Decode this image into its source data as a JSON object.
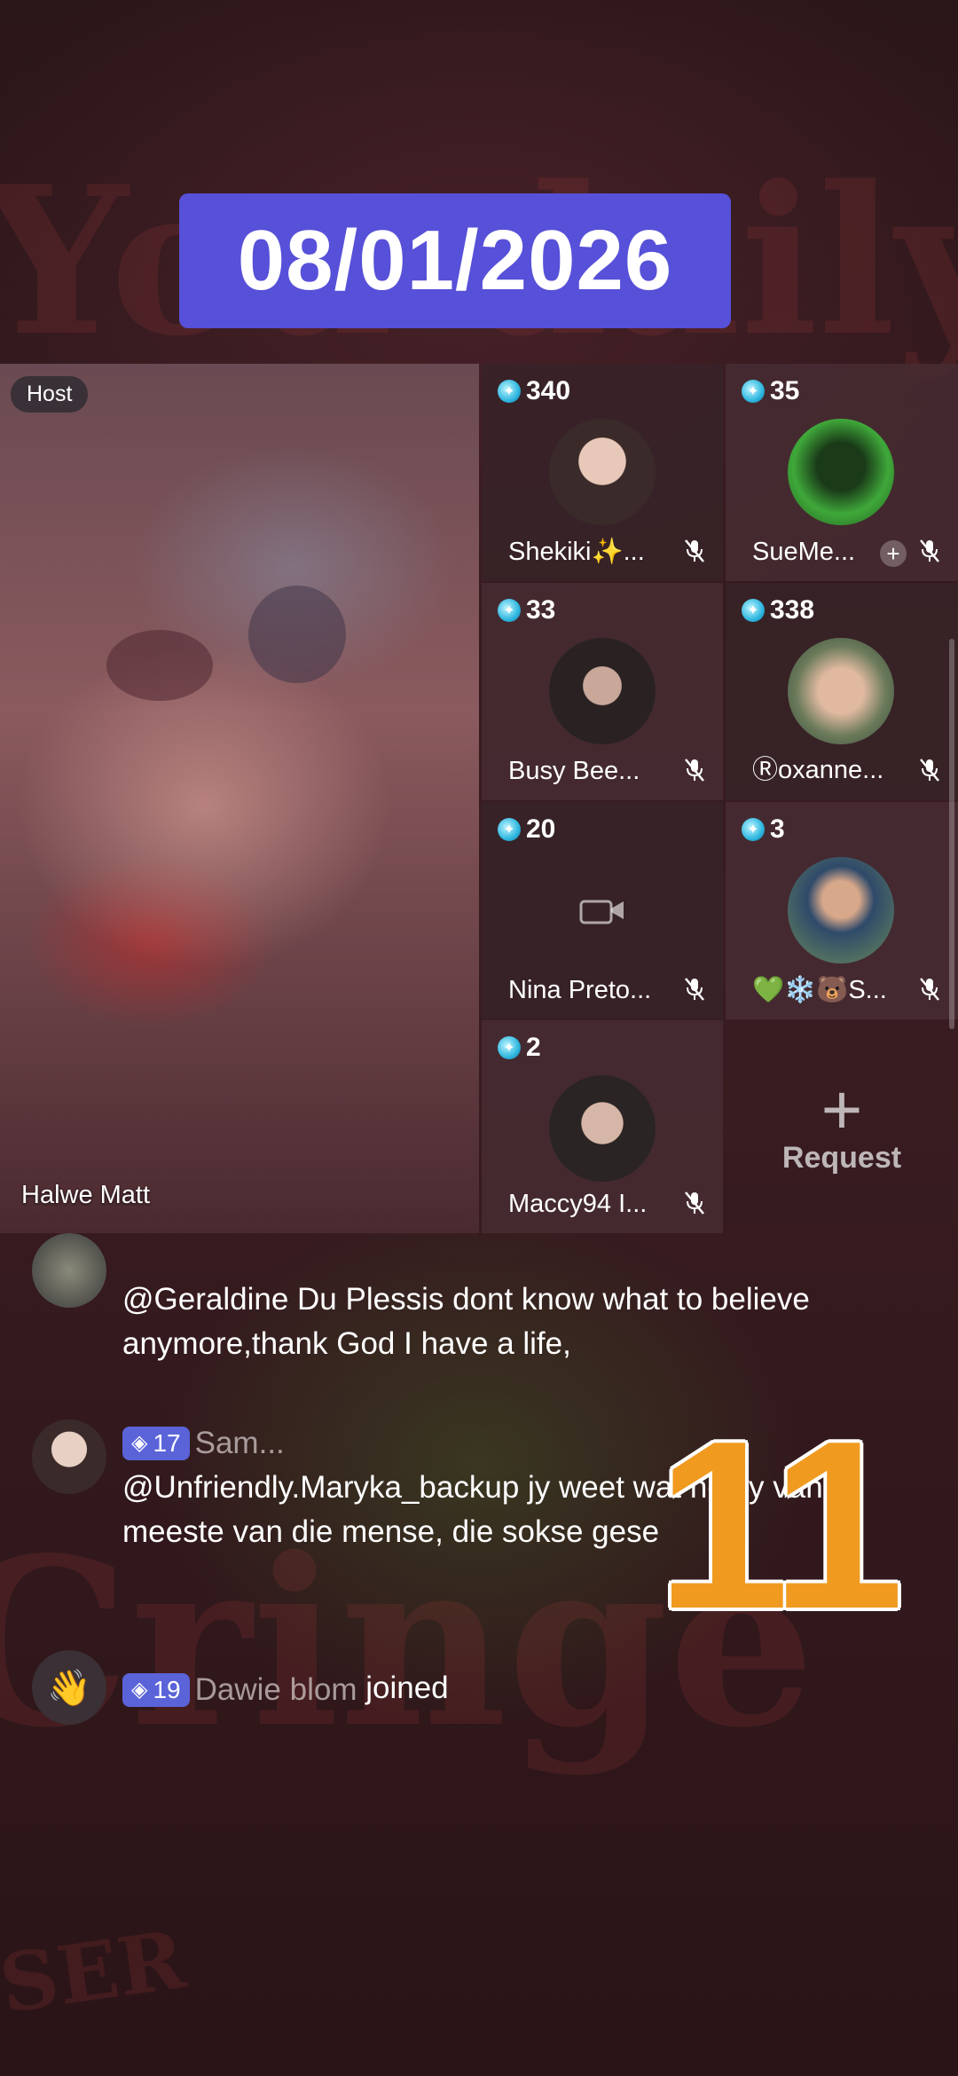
{
  "date_badge": "08/01/2026",
  "host": {
    "tag": "Host",
    "name": "Halwe Matt"
  },
  "guests": [
    {
      "count": "340",
      "name": "Shekiki✨...",
      "icon": "avatar-photo"
    },
    {
      "count": "35",
      "name": "SueMe...",
      "icon": "avatar-photo"
    },
    {
      "count": "33",
      "name": "Busy Bee...",
      "icon": "avatar-photo"
    },
    {
      "count": "338",
      "name": "Ⓡoxanne...",
      "icon": "avatar-photo"
    },
    {
      "count": "20",
      "name": "Nina Preto...",
      "icon": "camera-off-icon"
    },
    {
      "count": "3",
      "name": "💚❄️🐻S...",
      "icon": "avatar-photo"
    },
    {
      "count": "2",
      "name": "Maccy94 I...",
      "icon": "avatar-photo"
    }
  ],
  "request": {
    "plus": "+",
    "label": "Request"
  },
  "comments": [
    {
      "text": "@Geraldine Du Plessis dont know what to believe anymore,thank God I have a life,"
    },
    {
      "level": "17",
      "username": "Sam...",
      "text": "@Unfriendly.Maryka_backup jy weet wat het jy van meeste van die mense, die sokse gese"
    },
    {
      "level": "19",
      "username": "Dawie blom",
      "action": "joined"
    }
  ],
  "overlay_number": "11",
  "colors": {
    "date_badge": "#5750d8",
    "level_badge": "#5a63d8",
    "overlay_number": "#f09a20"
  }
}
